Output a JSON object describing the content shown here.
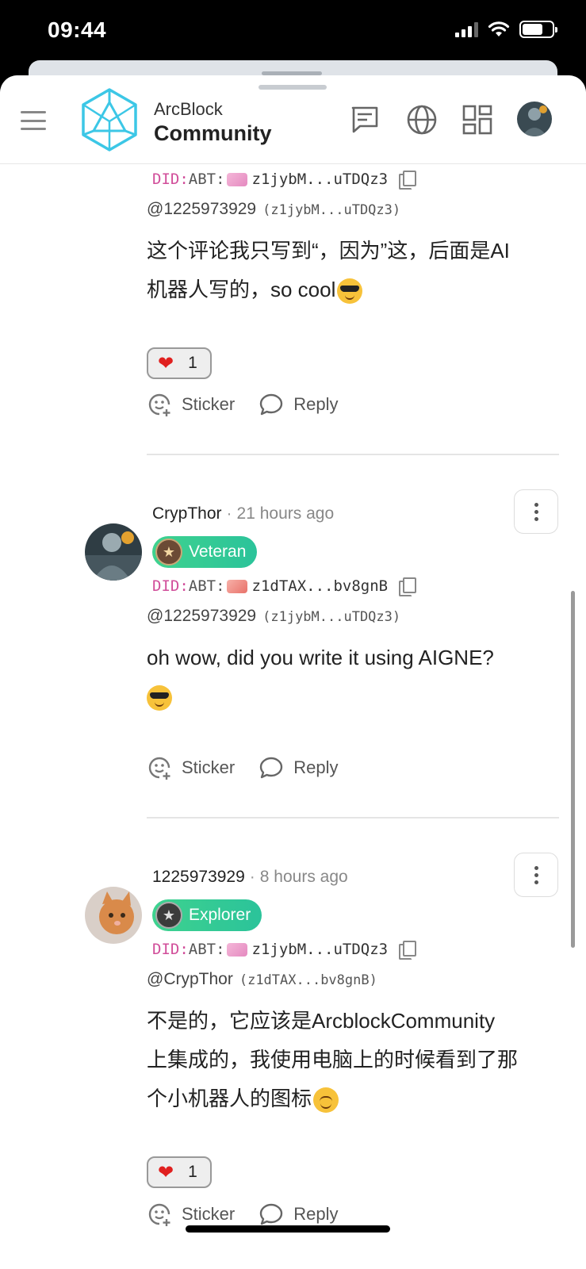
{
  "status_bar": {
    "time": "09:44"
  },
  "header": {
    "logo_small": "ArcBlock",
    "logo_big": "Community"
  },
  "comments": [
    {
      "did_prefix": "DID:",
      "did_chain": "ABT:",
      "did_addr": "z1jybM...uTDQz3",
      "mention_name": "@1225973929",
      "mention_addr": "(z1jybM...uTDQz3)",
      "body_line1": "这个评论我只写到“，因为”这，后面是AI",
      "body_line2": "机器人写的，so cool",
      "reaction_count": "1",
      "sticker_label": "Sticker",
      "reply_label": "Reply"
    },
    {
      "author": "CrypThor",
      "sep": "·",
      "time": "21 hours ago",
      "badge": "Veteran",
      "did_prefix": "DID:",
      "did_chain": "ABT:",
      "did_addr": "z1dTAX...bv8gnB",
      "mention_name": "@1225973929",
      "mention_addr": "(z1jybM...uTDQz3)",
      "body_line1": "oh wow, did you write it using AIGNE?",
      "sticker_label": "Sticker",
      "reply_label": "Reply"
    },
    {
      "author": "1225973929",
      "sep": "·",
      "time": "8 hours ago",
      "badge": "Explorer",
      "did_prefix": "DID:",
      "did_chain": "ABT:",
      "did_addr": "z1jybM...uTDQz3",
      "mention_name": "@CrypThor",
      "mention_addr": "(z1dTAX...bv8gnB)",
      "body_line1": "不是的，它应该是ArcblockCommunity",
      "body_line2": "上集成的，我使用电脑上的时候看到了那",
      "body_line3": "个小机器人的图标",
      "reaction_count": "1",
      "sticker_label": "Sticker",
      "reply_label": "Reply"
    }
  ],
  "icons": {
    "menu": "menu-icon",
    "chat": "chat-icon",
    "globe": "globe-icon",
    "apps": "apps-grid-icon",
    "sticker": "sticker-icon",
    "reply": "reply-bubble-icon",
    "copy": "copy-icon",
    "more": "more-vertical-icon"
  }
}
